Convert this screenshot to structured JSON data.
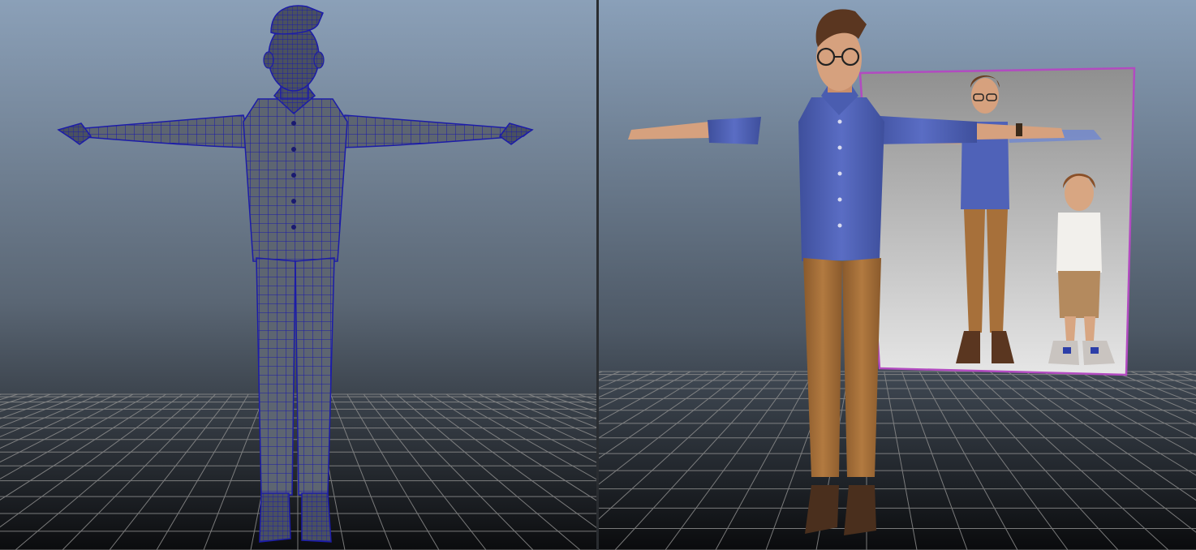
{
  "viewports": {
    "left": {
      "display_mode": "wireframe-on-shaded",
      "model": "male-character-tpose",
      "wire_color": "#1c1ca8"
    },
    "right": {
      "display_mode": "smooth-shaded-textured",
      "model": "male-character-tpose",
      "image_plane": "character-reference-sheet"
    }
  },
  "colors": {
    "bg_top": "#8b9fb6",
    "bg_bottom": "#0d0f12",
    "grid_line": "#8c8c8c",
    "shirt": "#4f62b8",
    "pants": "#a7703a",
    "skin": "#d6a17e",
    "hair": "#5a3620",
    "shoes": "#4a2f1d",
    "mesh_base": "#5c6470",
    "image_plane_border": "#b24bc0"
  }
}
